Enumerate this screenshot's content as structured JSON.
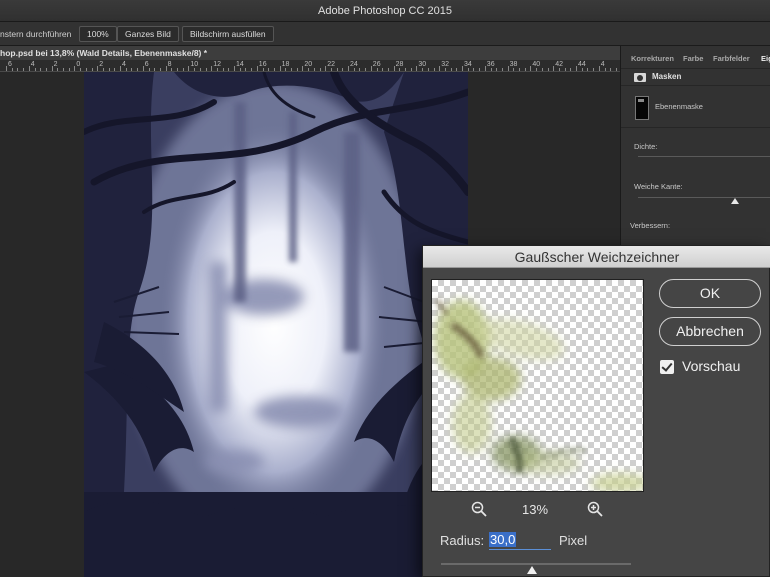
{
  "app": {
    "title": "Adobe Photoshop CC 2015"
  },
  "options_bar": {
    "truncated_text": "nstern durchführen",
    "buttons": [
      {
        "label": "100%"
      },
      {
        "label": "Ganzes Bild"
      },
      {
        "label": "Bildschirm ausfüllen"
      }
    ]
  },
  "document": {
    "tab_title": "hop.psd bei 13,8% (Wald Details, Ebenenmaske/8) *"
  },
  "ruler": {
    "labels": [
      "6",
      "4",
      "2",
      "0",
      "2",
      "4",
      "6",
      "8",
      "10",
      "12",
      "14",
      "16",
      "18",
      "20",
      "22",
      "24",
      "26",
      "28",
      "30",
      "32",
      "34",
      "36",
      "38",
      "40",
      "42",
      "44",
      "4"
    ]
  },
  "properties_panel": {
    "tabs": [
      "Korrekturen",
      "Farbe",
      "Farbfelder",
      "Eig"
    ],
    "active_tab_index": 3,
    "masks_label": "Masken",
    "layer_mask_label": "Ebenenmaske",
    "density_label": "Dichte:",
    "feather_label": "Weiche Kante:",
    "refine_label": "Verbessern:"
  },
  "gaussian_blur_dialog": {
    "title": "Gaußscher Weichzeichner",
    "ok_label": "OK",
    "cancel_label": "Abbrechen",
    "preview_label": "Vorschau",
    "preview_checked": true,
    "zoom_level": "13%",
    "radius_label": "Radius:",
    "radius_value": "30,0",
    "radius_unit": "Pixel",
    "zoom_out_icon": "zoom-out-icon",
    "zoom_in_icon": "zoom-in-icon"
  }
}
